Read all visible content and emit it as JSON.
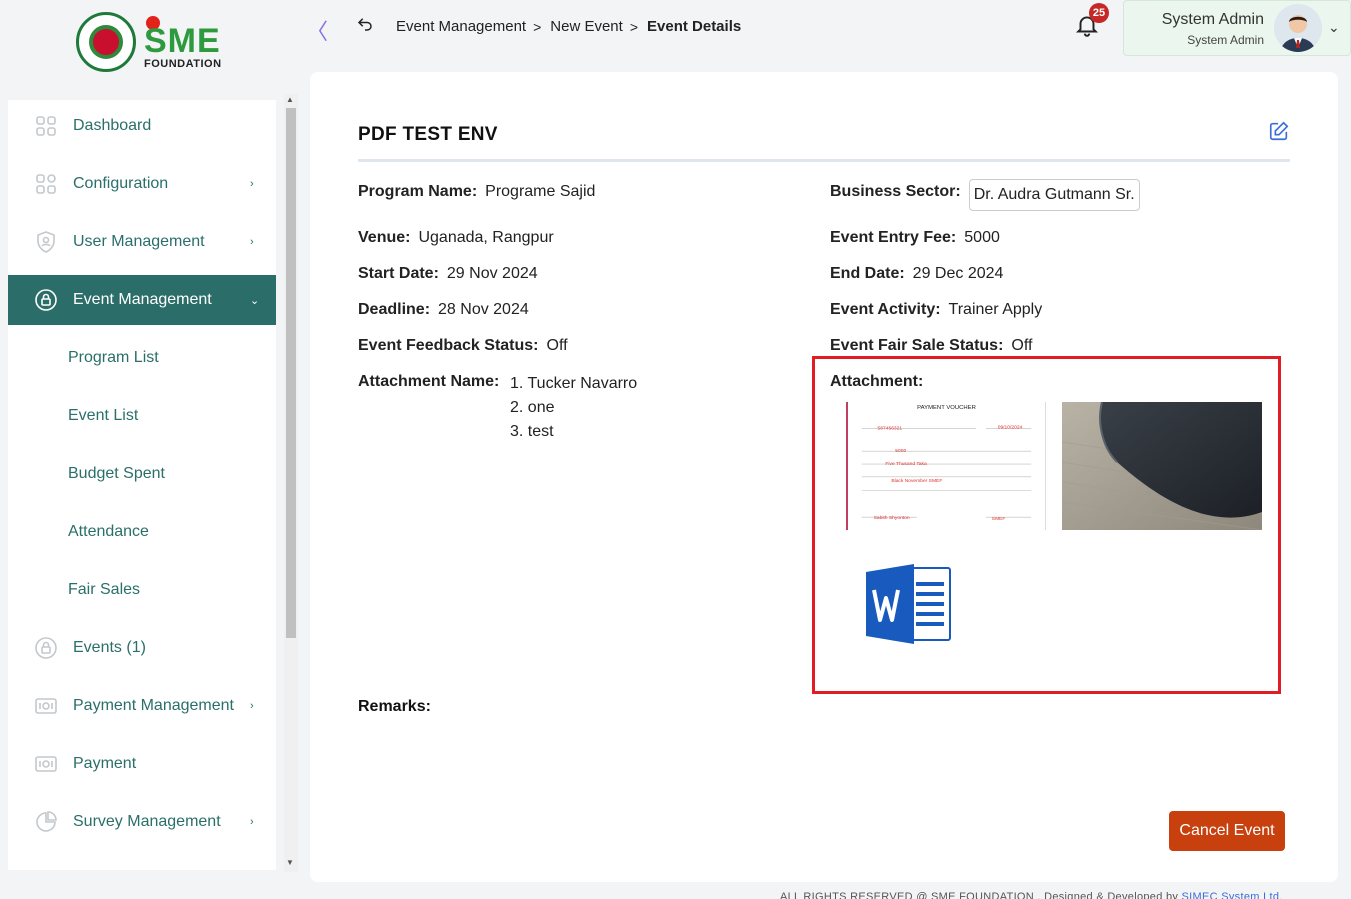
{
  "brand": {
    "logo_text": "SME",
    "logo_sub": "FOUNDATION"
  },
  "sidebar": {
    "items": [
      {
        "label": "Dashboard",
        "icon": "dashboard-icon",
        "has_arrow": false
      },
      {
        "label": "Configuration",
        "icon": "configuration-icon",
        "has_arrow": true
      },
      {
        "label": "User Management",
        "icon": "shield-icon",
        "has_arrow": true
      },
      {
        "label": "Event Management",
        "icon": "lock-icon",
        "has_arrow": true,
        "active": true
      }
    ],
    "sub_items": [
      "Program List",
      "Event List",
      "Budget Spent",
      "Attendance",
      "Fair Sales"
    ],
    "items_after": [
      {
        "label": "Events (1)",
        "icon": "lock-icon"
      },
      {
        "label": "Payment Management",
        "icon": "money-icon",
        "has_arrow": true
      },
      {
        "label": "Payment",
        "icon": "money-icon"
      },
      {
        "label": "Survey Management",
        "icon": "pie-chart-icon",
        "has_arrow": true
      }
    ],
    "arrow_glyph": "›",
    "active_arrow_glyph": "⌄"
  },
  "header": {
    "collapse_glyph": "〈",
    "breadcrumb": [
      "Event Management",
      "New Event",
      "Event Details"
    ],
    "breadcrumb_sep": ">",
    "notification_count": "25",
    "user_name": "System Admin",
    "user_role": "System Admin",
    "chevron": "⌄"
  },
  "event": {
    "title": "PDF TEST ENV",
    "program_name_label": "Program Name:",
    "program_name": "Programe Sajid",
    "business_sector_label": "Business Sector:",
    "business_sector": "Dr. Audra Gutmann Sr.",
    "venue_label": "Venue:",
    "venue": "Uganada, Rangpur",
    "entry_fee_label": "Event Entry Fee:",
    "entry_fee": "5000",
    "start_date_label": "Start Date:",
    "start_date": "29 Nov 2024",
    "end_date_label": "End Date:",
    "end_date": "29 Dec 2024",
    "deadline_label": "Deadline:",
    "deadline": "28 Nov 2024",
    "activity_label": "Event Activity:",
    "activity": "Trainer Apply",
    "feedback_status_label": "Event Feedback Status:",
    "feedback_status": "Off",
    "fair_sale_status_label": "Event Fair Sale Status:",
    "fair_sale_status": "Off",
    "attachment_name_label": "Attachment Name:",
    "attachment_names": [
      "1. Tucker Navarro",
      "2. one",
      "3. test"
    ],
    "attachment_label": "Attachment:",
    "remarks_label": "Remarks:",
    "cancel_label": "Cancel Event"
  },
  "voucher": {
    "title": "PAYMENT VOUCHER",
    "no": "587456321",
    "date": "09/10/2024",
    "amount": "5000",
    "in_words": "Five Thusand Taka",
    "payee": "Black November SMEF",
    "sign_left": "Sabith Shyonton",
    "sign_right": "SMEF"
  },
  "footer": {
    "text": "ALL RIGHTS RESERVED @ SME FOUNDATION . Designed & Developed by",
    "link": "SIMEC System Ltd."
  }
}
